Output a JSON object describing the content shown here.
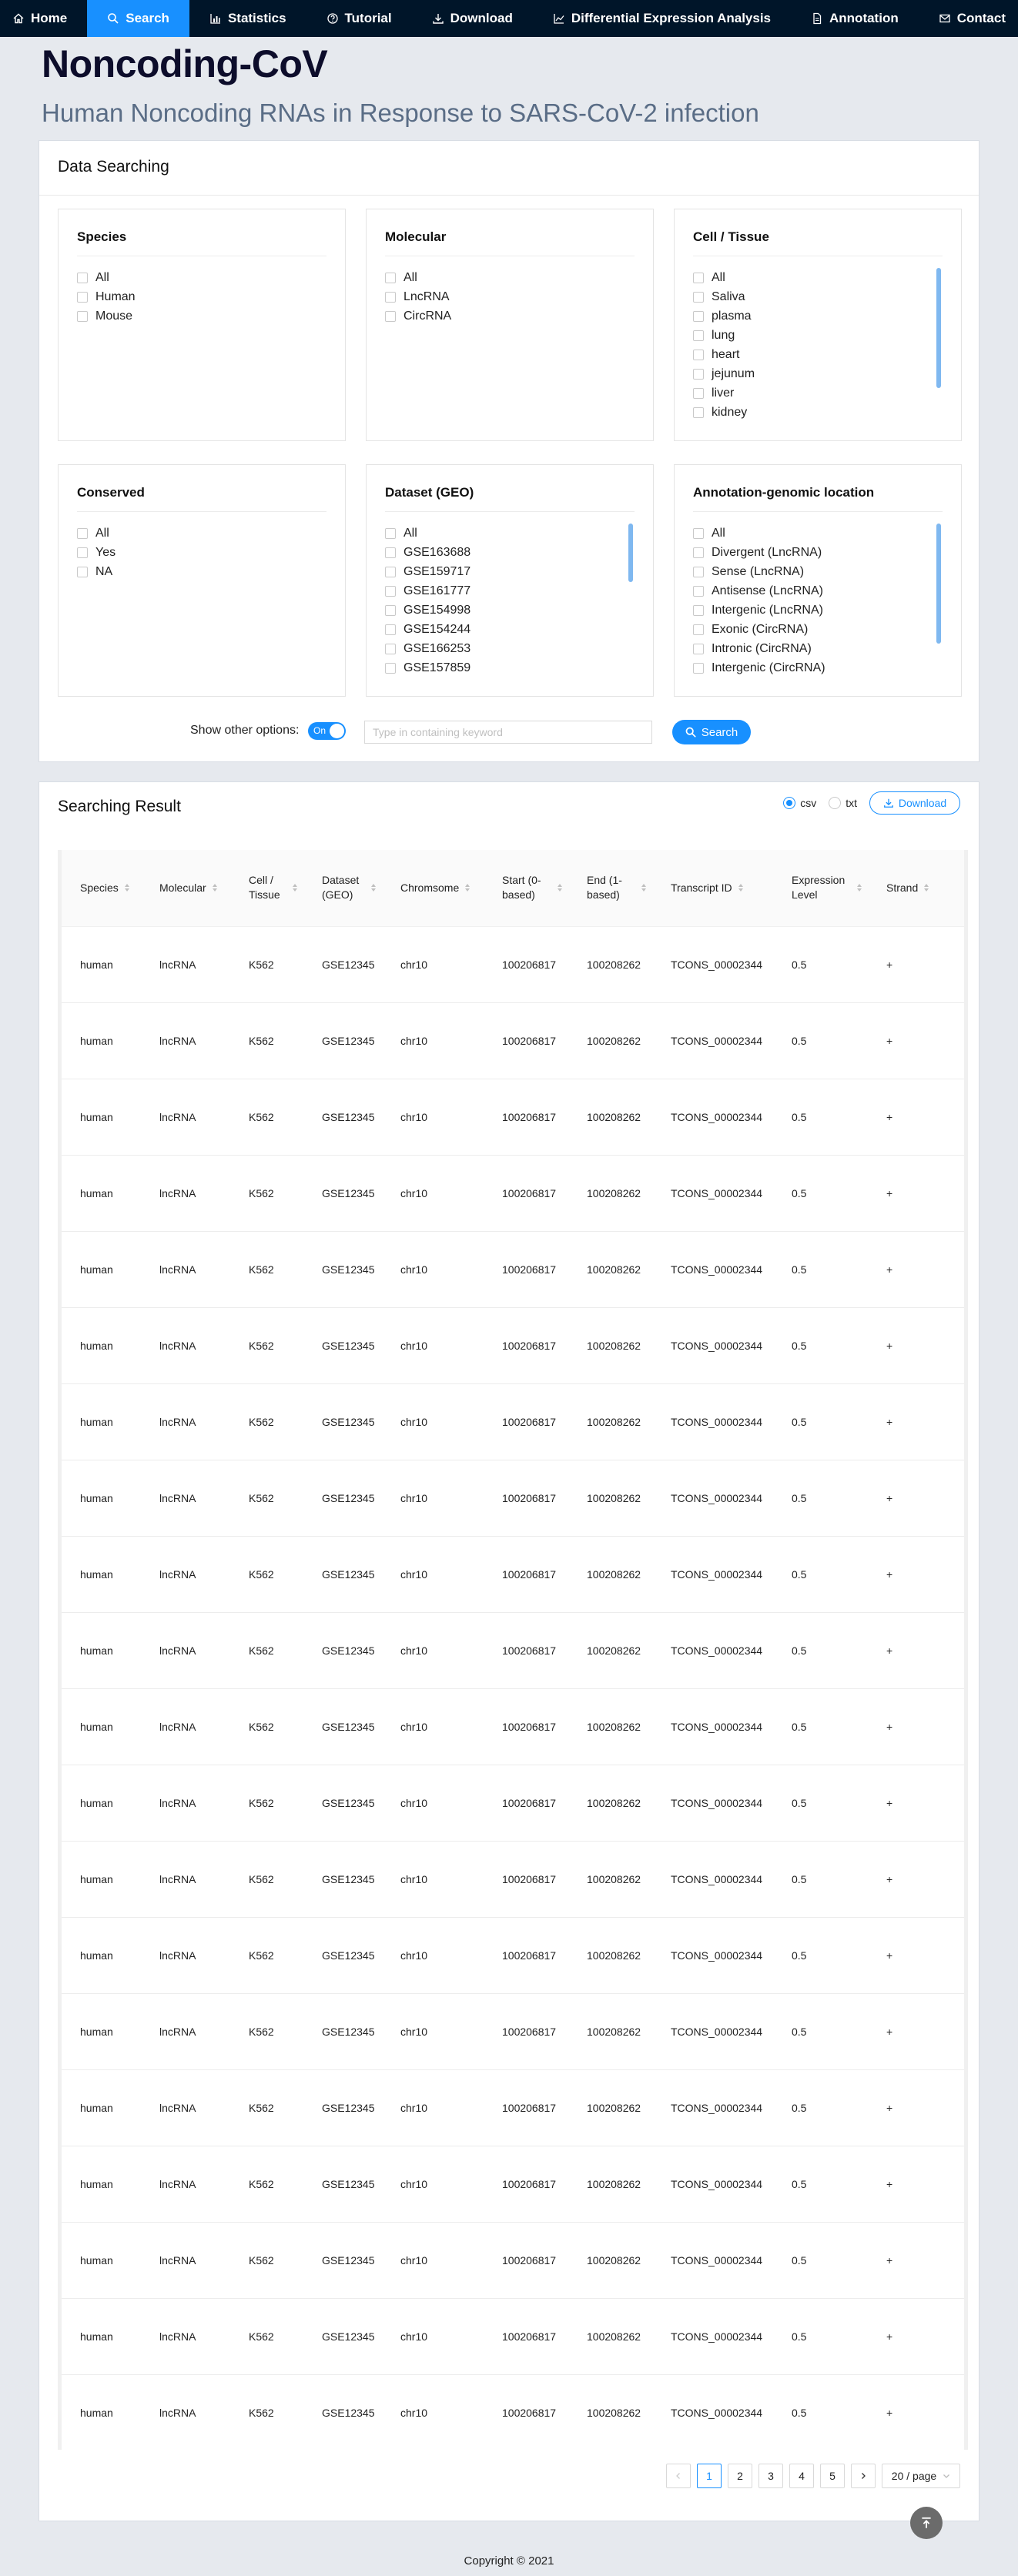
{
  "nav": [
    {
      "label": "Home",
      "icon": "home-icon"
    },
    {
      "label": "Search",
      "icon": "search-icon",
      "active": true
    },
    {
      "label": "Statistics",
      "icon": "bar-chart-icon"
    },
    {
      "label": "Tutorial",
      "icon": "question-circle-icon"
    },
    {
      "label": "Download",
      "icon": "download-icon"
    },
    {
      "label": "Differential Expression Analysis",
      "icon": "line-chart-icon"
    },
    {
      "label": "Annotation",
      "icon": "file-icon"
    },
    {
      "label": "Contact",
      "icon": "mail-icon"
    }
  ],
  "header": {
    "title": "Noncoding-CoV",
    "subtitle": "Human Noncoding RNAs in Response to SARS-CoV-2 infection"
  },
  "search_panel": {
    "title": "Data Searching",
    "filters": [
      {
        "title": "Species",
        "options": [
          "All",
          "Human",
          "Mouse"
        ],
        "scroll": false
      },
      {
        "title": "Molecular",
        "options": [
          "All",
          "LncRNA",
          "CircRNA"
        ],
        "scroll": false
      },
      {
        "title": "Cell / Tissue",
        "options": [
          "All",
          "Saliva",
          "plasma",
          "lung",
          "heart",
          "jejunum",
          "liver",
          "kidney"
        ],
        "scroll": true
      },
      {
        "title": "Conserved",
        "options": [
          "All",
          "Yes",
          "NA"
        ],
        "scroll": false
      },
      {
        "title": "Dataset (GEO)",
        "options": [
          "All",
          "GSE163688",
          "GSE159717",
          "GSE161777",
          "GSE154998",
          "GSE154244",
          "GSE166253",
          "GSE157859"
        ],
        "scroll": true
      },
      {
        "title": "Annotation-genomic location",
        "options": [
          "All",
          "Divergent (LncRNA)",
          "Sense (LncRNA)",
          "Antisense (LncRNA)",
          "Intergenic (LncRNA)",
          "Exonic (CircRNA)",
          "Intronic (CircRNA)",
          "Intergenic (CircRNA)"
        ],
        "scroll": true
      }
    ],
    "show_other_label": "Show other options:",
    "toggle_text": "On",
    "keyword_placeholder": "Type in containing keyword",
    "search_button": "Search"
  },
  "result_panel": {
    "title": "Searching Result",
    "formats": [
      {
        "label": "csv",
        "checked": true
      },
      {
        "label": "txt",
        "checked": false
      }
    ],
    "download_button": "Download",
    "columns": [
      "Species",
      "Molecular",
      "Cell / Tissue",
      "Dataset (GEO)",
      "Chromsome",
      "Start (0-based)",
      "End (1-based)",
      "Transcript ID",
      "Expression Level",
      "Strand"
    ],
    "rows": [
      [
        "human",
        "lncRNA",
        "K562",
        "GSE12345",
        "chr10",
        "100206817",
        "100208262",
        "TCONS_00002344",
        "0.5",
        "+"
      ],
      [
        "human",
        "lncRNA",
        "K562",
        "GSE12345",
        "chr10",
        "100206817",
        "100208262",
        "TCONS_00002344",
        "0.5",
        "+"
      ],
      [
        "human",
        "lncRNA",
        "K562",
        "GSE12345",
        "chr10",
        "100206817",
        "100208262",
        "TCONS_00002344",
        "0.5",
        "+"
      ],
      [
        "human",
        "lncRNA",
        "K562",
        "GSE12345",
        "chr10",
        "100206817",
        "100208262",
        "TCONS_00002344",
        "0.5",
        "+"
      ],
      [
        "human",
        "lncRNA",
        "K562",
        "GSE12345",
        "chr10",
        "100206817",
        "100208262",
        "TCONS_00002344",
        "0.5",
        "+"
      ],
      [
        "human",
        "lncRNA",
        "K562",
        "GSE12345",
        "chr10",
        "100206817",
        "100208262",
        "TCONS_00002344",
        "0.5",
        "+"
      ],
      [
        "human",
        "lncRNA",
        "K562",
        "GSE12345",
        "chr10",
        "100206817",
        "100208262",
        "TCONS_00002344",
        "0.5",
        "+"
      ],
      [
        "human",
        "lncRNA",
        "K562",
        "GSE12345",
        "chr10",
        "100206817",
        "100208262",
        "TCONS_00002344",
        "0.5",
        "+"
      ],
      [
        "human",
        "lncRNA",
        "K562",
        "GSE12345",
        "chr10",
        "100206817",
        "100208262",
        "TCONS_00002344",
        "0.5",
        "+"
      ],
      [
        "human",
        "lncRNA",
        "K562",
        "GSE12345",
        "chr10",
        "100206817",
        "100208262",
        "TCONS_00002344",
        "0.5",
        "+"
      ],
      [
        "human",
        "lncRNA",
        "K562",
        "GSE12345",
        "chr10",
        "100206817",
        "100208262",
        "TCONS_00002344",
        "0.5",
        "+"
      ],
      [
        "human",
        "lncRNA",
        "K562",
        "GSE12345",
        "chr10",
        "100206817",
        "100208262",
        "TCONS_00002344",
        "0.5",
        "+"
      ],
      [
        "human",
        "lncRNA",
        "K562",
        "GSE12345",
        "chr10",
        "100206817",
        "100208262",
        "TCONS_00002344",
        "0.5",
        "+"
      ],
      [
        "human",
        "lncRNA",
        "K562",
        "GSE12345",
        "chr10",
        "100206817",
        "100208262",
        "TCONS_00002344",
        "0.5",
        "+"
      ],
      [
        "human",
        "lncRNA",
        "K562",
        "GSE12345",
        "chr10",
        "100206817",
        "100208262",
        "TCONS_00002344",
        "0.5",
        "+"
      ],
      [
        "human",
        "lncRNA",
        "K562",
        "GSE12345",
        "chr10",
        "100206817",
        "100208262",
        "TCONS_00002344",
        "0.5",
        "+"
      ],
      [
        "human",
        "lncRNA",
        "K562",
        "GSE12345",
        "chr10",
        "100206817",
        "100208262",
        "TCONS_00002344",
        "0.5",
        "+"
      ],
      [
        "human",
        "lncRNA",
        "K562",
        "GSE12345",
        "chr10",
        "100206817",
        "100208262",
        "TCONS_00002344",
        "0.5",
        "+"
      ],
      [
        "human",
        "lncRNA",
        "K562",
        "GSE12345",
        "chr10",
        "100206817",
        "100208262",
        "TCONS_00002344",
        "0.5",
        "+"
      ],
      [
        "human",
        "lncRNA",
        "K562",
        "GSE12345",
        "chr10",
        "100206817",
        "100208262",
        "TCONS_00002344",
        "0.5",
        "+"
      ]
    ],
    "pagination": {
      "pages": [
        "1",
        "2",
        "3",
        "4",
        "5"
      ],
      "current": "1",
      "prev_icon": "chevron-left-icon",
      "next_icon": "chevron-right-icon",
      "page_size": "20 / page"
    }
  },
  "back_to_top_icon": "vertical-align-top-icon",
  "footer": "Copyright © 2021",
  "colors": {
    "nav_bg": "#001529",
    "accent": "#1890ff",
    "page_bg": "#e6e9ee"
  }
}
